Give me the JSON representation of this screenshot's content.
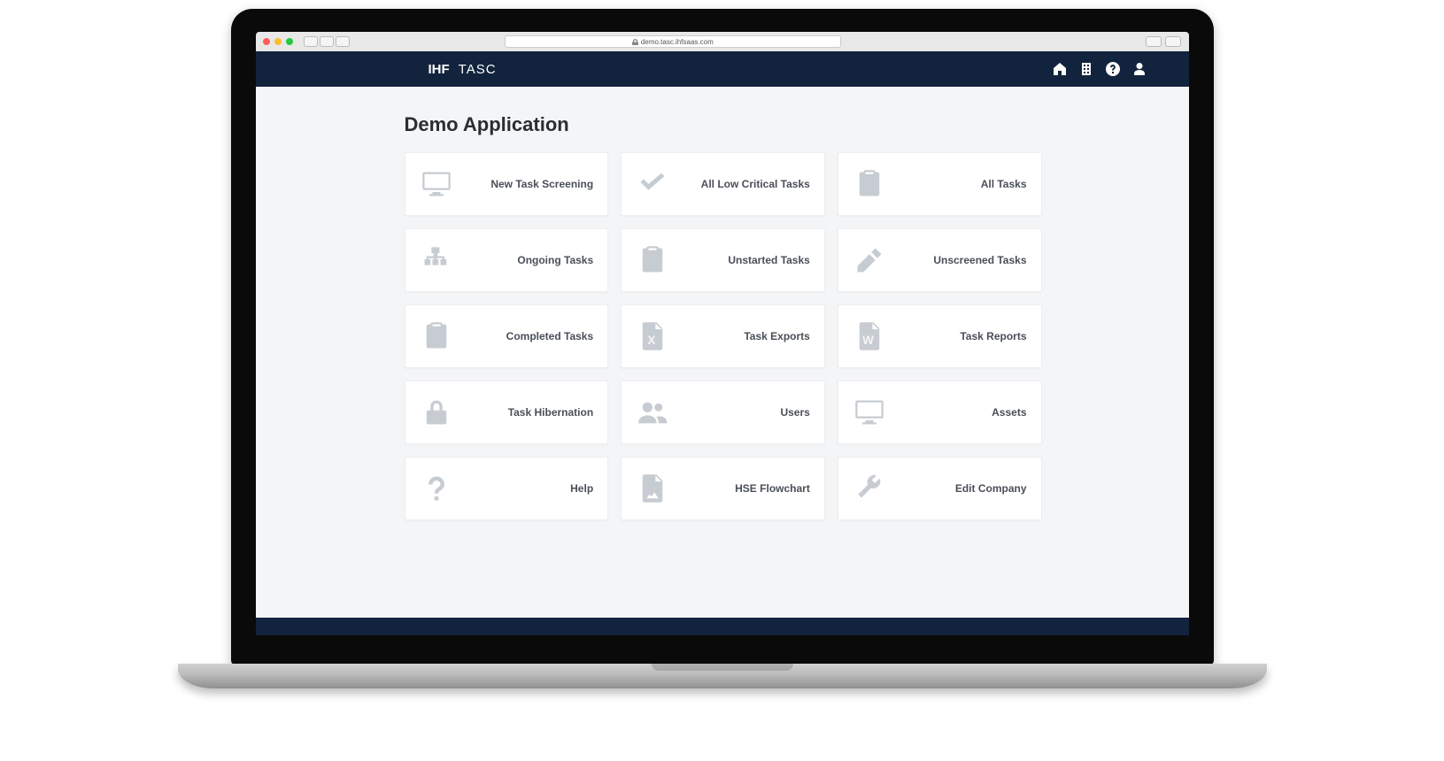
{
  "browser": {
    "url": "demo.tasc.ihfsaas.com"
  },
  "header": {
    "logo_text": "IHF",
    "app_name": "TASC"
  },
  "page": {
    "title": "Demo Application"
  },
  "cards": [
    {
      "label": "New Task Screening",
      "icon": "monitor"
    },
    {
      "label": "All Low Critical Tasks",
      "icon": "check"
    },
    {
      "label": "All Tasks",
      "icon": "clipboard-list"
    },
    {
      "label": "Ongoing Tasks",
      "icon": "sitemap"
    },
    {
      "label": "Unstarted Tasks",
      "icon": "clipboard"
    },
    {
      "label": "Unscreened Tasks",
      "icon": "pencil"
    },
    {
      "label": "Completed Tasks",
      "icon": "clipboard-check"
    },
    {
      "label": "Task Exports",
      "icon": "file-x"
    },
    {
      "label": "Task Reports",
      "icon": "file-w"
    },
    {
      "label": "Task Hibernation",
      "icon": "lock"
    },
    {
      "label": "Users",
      "icon": "users"
    },
    {
      "label": "Assets",
      "icon": "monitor"
    },
    {
      "label": "Help",
      "icon": "question"
    },
    {
      "label": "HSE Flowchart",
      "icon": "file-image"
    },
    {
      "label": "Edit Company",
      "icon": "wrench"
    }
  ]
}
